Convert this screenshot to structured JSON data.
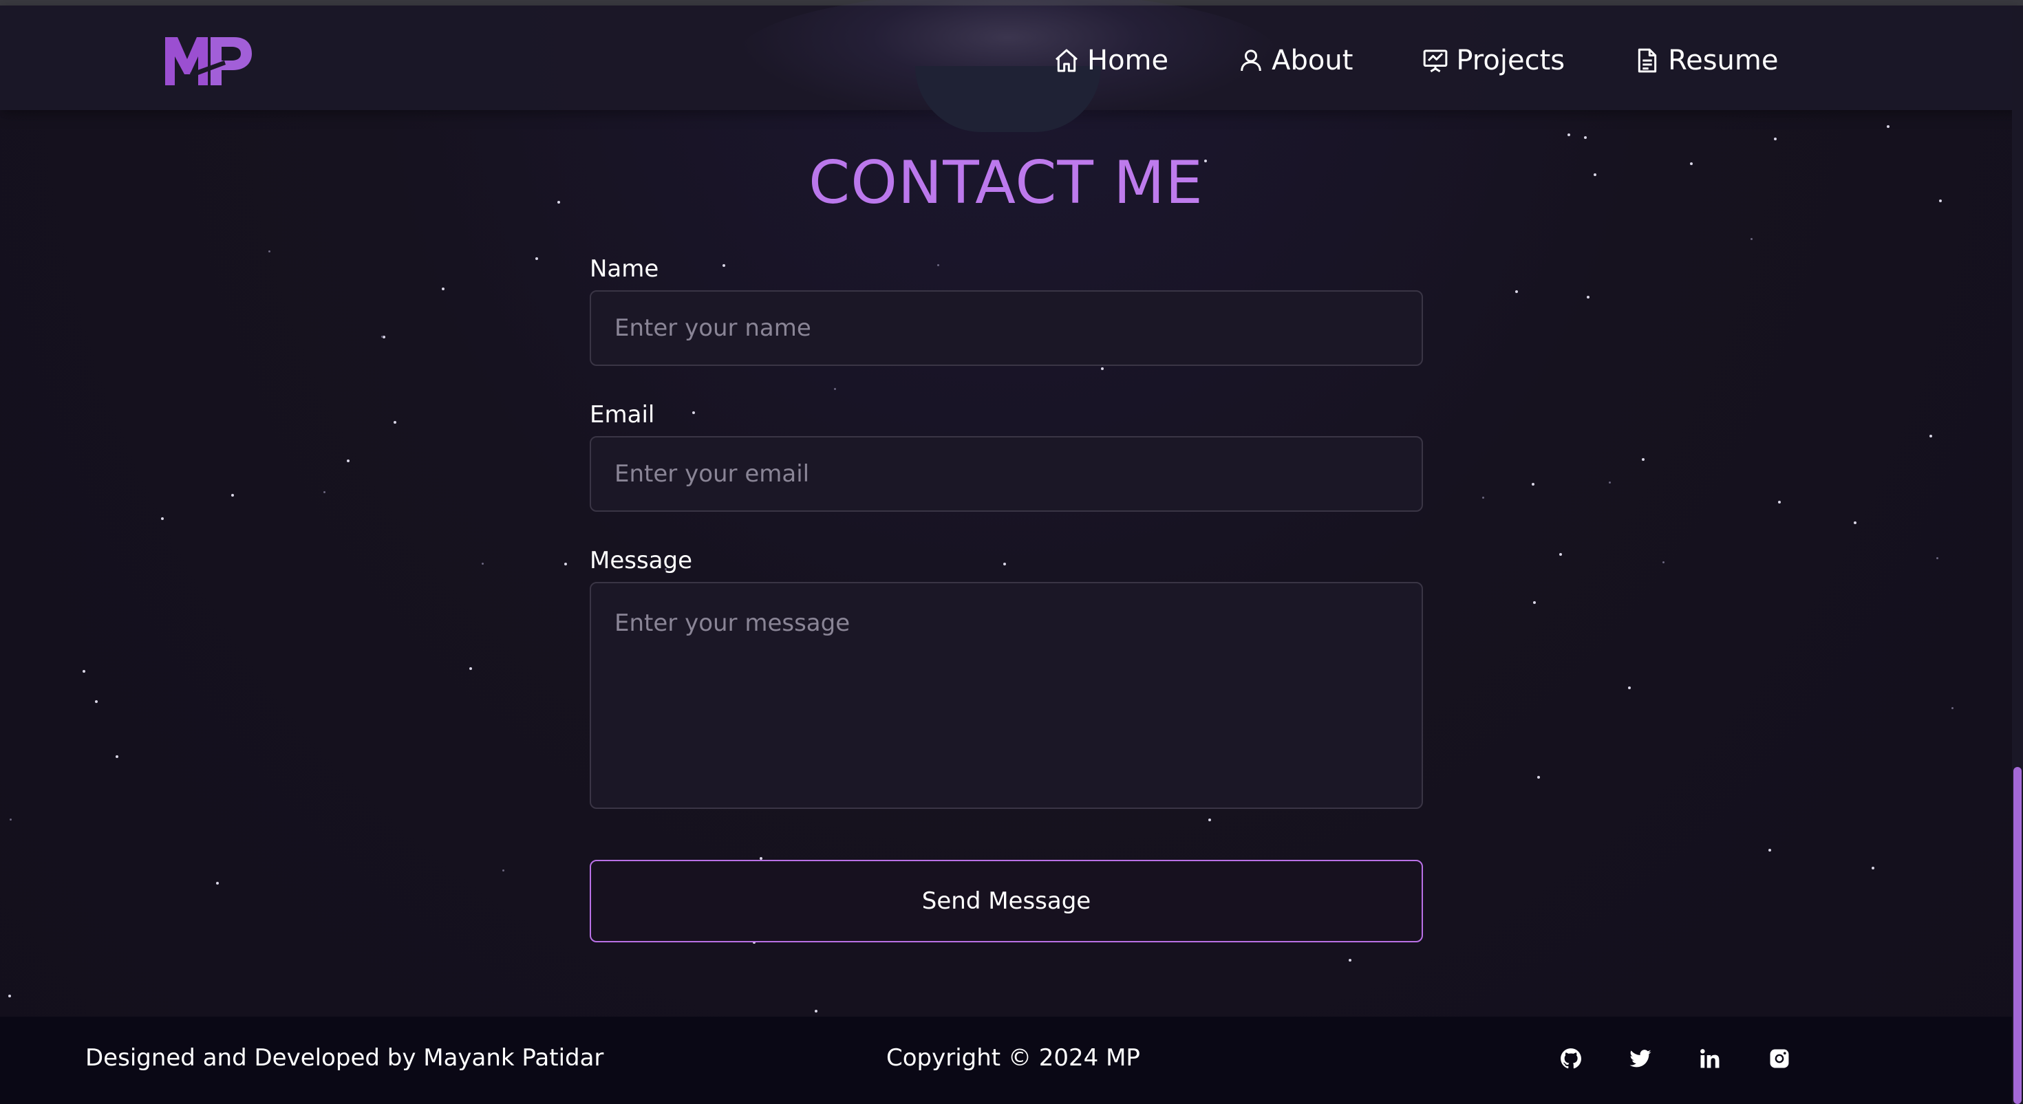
{
  "nav": {
    "logo_text": "MP",
    "items": [
      {
        "label": "Home",
        "icon": "home-icon"
      },
      {
        "label": "About",
        "icon": "user-icon"
      },
      {
        "label": "Projects",
        "icon": "presentation-chart-icon"
      },
      {
        "label": "Resume",
        "icon": "document-icon"
      }
    ]
  },
  "contact": {
    "title": "CONTACT ME",
    "name_label": "Name",
    "name_placeholder": "Enter your name",
    "email_label": "Email",
    "email_placeholder": "Enter your email",
    "message_label": "Message",
    "message_placeholder": "Enter your message",
    "send_label": "Send Message"
  },
  "footer": {
    "credit": "Designed and Developed by Mayank Patidar",
    "copyright": "Copyright © 2024 MP",
    "socials": [
      "github-icon",
      "twitter-icon",
      "linkedin-icon",
      "instagram-icon"
    ]
  },
  "colors": {
    "accent": "#c77dff",
    "background": "#15111f",
    "footer_bg": "#0a0815"
  }
}
